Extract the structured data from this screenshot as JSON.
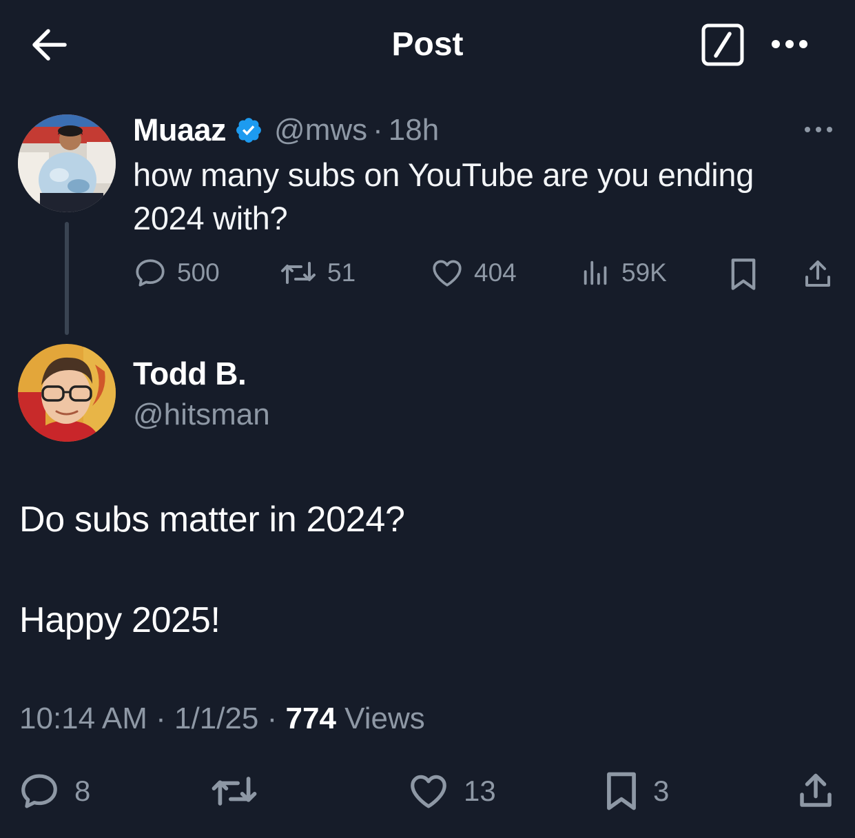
{
  "header": {
    "title": "Post",
    "back_icon": "arrow-left-icon",
    "compose_icon": "compose-icon",
    "more_icon": "more-horizontal-icon"
  },
  "parent_post": {
    "author_name": "Muaaz",
    "verified": true,
    "handle": "@mws",
    "separator": "·",
    "time": "18h",
    "text": "how many subs on YouTube are you ending 2024 with?",
    "actions": {
      "replies": "500",
      "reposts": "51",
      "likes": "404",
      "views": "59K"
    }
  },
  "reply_post": {
    "author_name": "Todd B.",
    "handle": "@hitsman",
    "text_line1": "Do subs matter in 2024?",
    "text_line2": "Happy 2025!",
    "meta": {
      "time": "10:14 AM",
      "separator": "·",
      "date": "1/1/25",
      "views_count": "774",
      "views_label": "Views"
    },
    "actions": {
      "replies": "8",
      "likes": "13",
      "bookmarks": "3"
    }
  },
  "colors": {
    "background": "#161c29",
    "muted_text": "#8e98a5",
    "verified_blue": "#1d9bf0"
  }
}
